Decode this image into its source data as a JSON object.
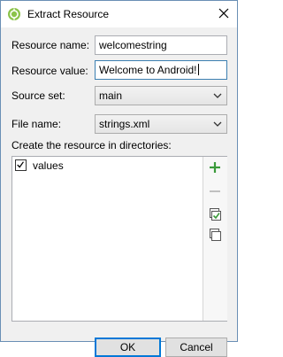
{
  "window": {
    "title": "Extract Resource",
    "close_icon": "close-icon"
  },
  "form": {
    "resource_name_label": "Resource name:",
    "resource_name_value": "welcomestring",
    "resource_value_label": "Resource value:",
    "resource_value_value": "Welcome to Android!",
    "source_set_label": "Source set:",
    "source_set_value": "main",
    "file_name_label": "File name:",
    "file_name_value": "strings.xml",
    "directories_label": "Create the resource in directories:"
  },
  "directories": [
    {
      "label": "values",
      "checked": true
    }
  ],
  "side_tools": [
    "add-icon",
    "remove-icon",
    "select-all-icon",
    "unselect-all-icon"
  ],
  "buttons": {
    "ok_label": "OK",
    "cancel_label": "Cancel"
  },
  "colors": {
    "android_green": "#8bc34a",
    "add_green": "#3a9a3a",
    "focus_blue": "#3c7fb1",
    "default_button_border": "#0078d7"
  }
}
